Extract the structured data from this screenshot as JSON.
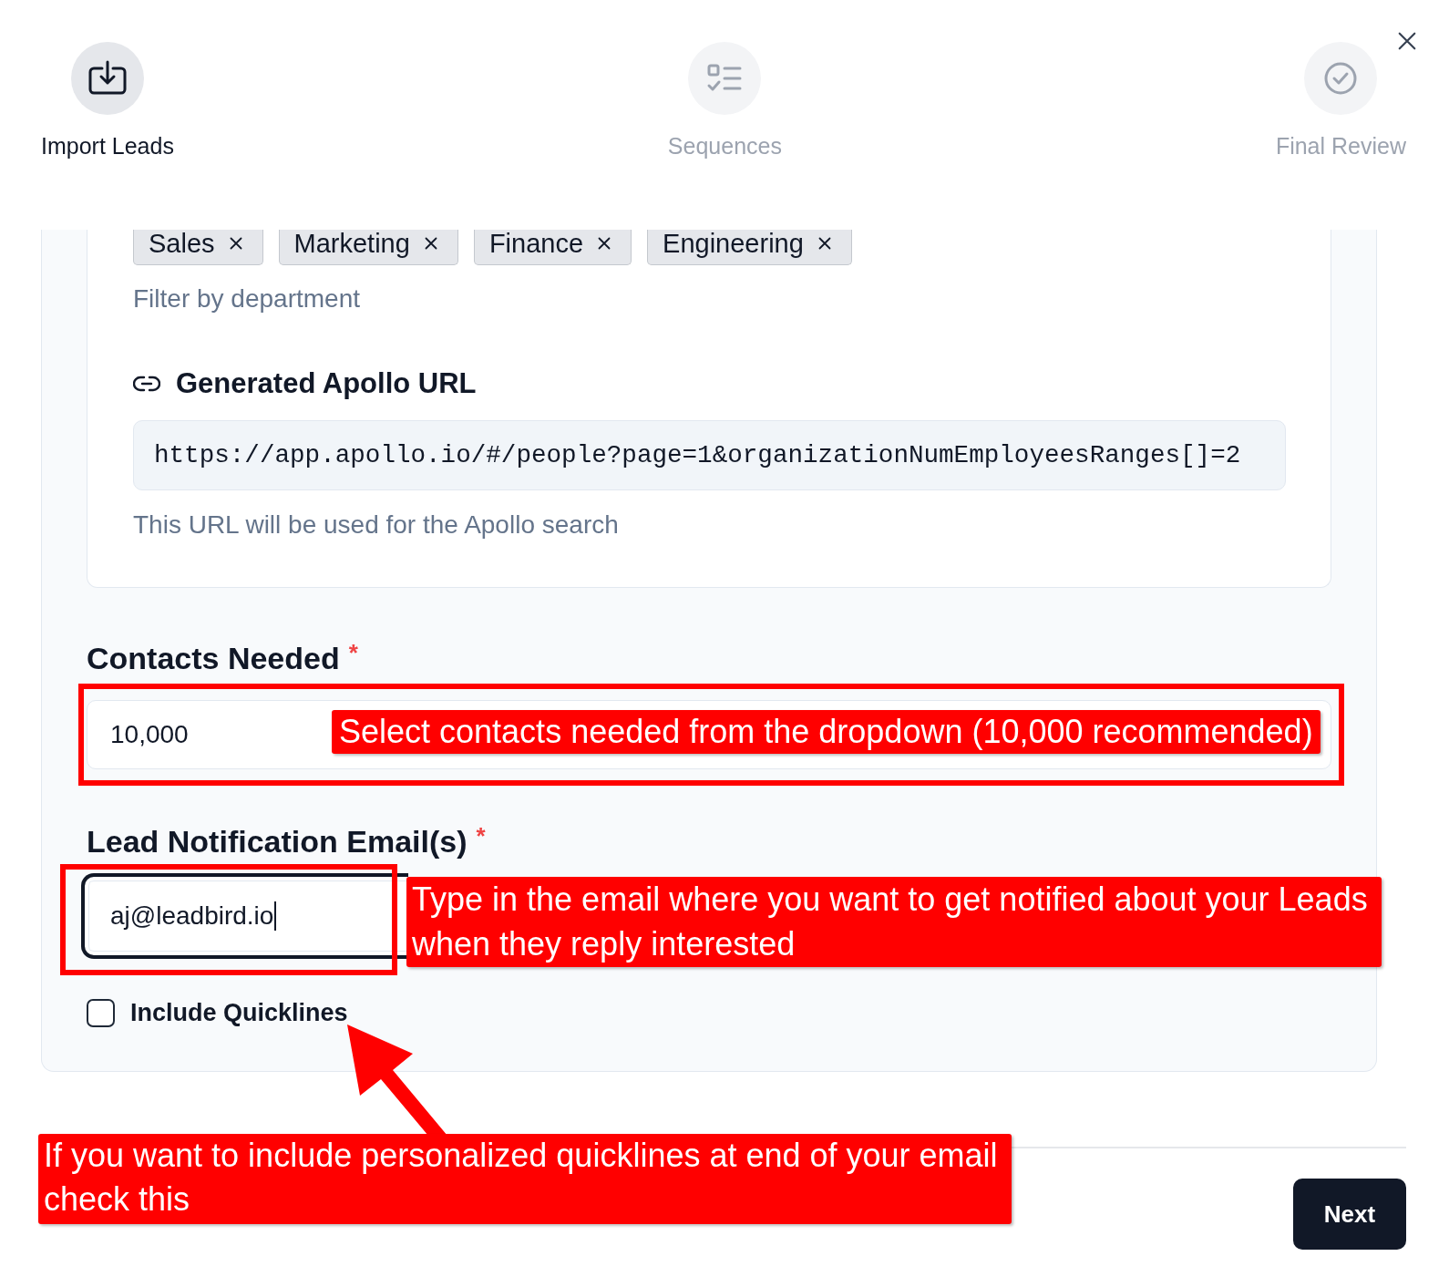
{
  "stepper": {
    "steps": [
      {
        "label": "Import Leads",
        "selected": true
      },
      {
        "label": "Sequences",
        "selected": false
      },
      {
        "label": "Final Review",
        "selected": false
      }
    ]
  },
  "department_filter": {
    "tags": [
      {
        "label": "Sales"
      },
      {
        "label": "Marketing"
      },
      {
        "label": "Finance"
      },
      {
        "label": "Engineering"
      }
    ],
    "help": "Filter by department"
  },
  "apollo_url": {
    "heading": "Generated Apollo URL",
    "value": "https://app.apollo.io/#/people?page=1&organizationNumEmployeesRanges[]=2",
    "help": "This URL will be used for the Apollo search"
  },
  "contacts_needed": {
    "label": "Contacts Needed",
    "required_mark": "*",
    "value": "10,000",
    "callout": "Select contacts needed from the dropdown (10,000 recommended)"
  },
  "lead_email": {
    "label": "Lead Notification Email(s)",
    "required_mark": "*",
    "value": "aj@leadbird.io",
    "focused": true,
    "callout": "Type in the email where you want to get notified about your Leads when they reply interested"
  },
  "quicklines": {
    "label": "Include Quicklines",
    "checked": false,
    "callout": "If you want to include personalized quicklines at end of your email check this"
  },
  "footer": {
    "next_button": "Next"
  }
}
